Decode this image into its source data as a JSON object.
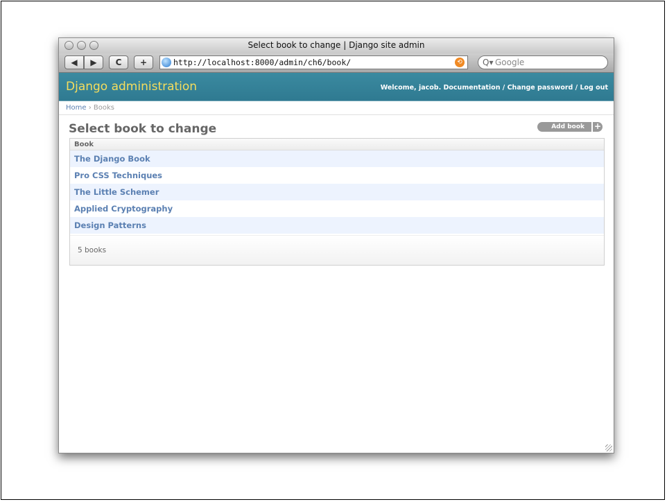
{
  "window": {
    "title": "Select book to change | Django site admin"
  },
  "toolbar": {
    "back_icon": "arrow-left-icon",
    "forward_icon": "arrow-right-icon",
    "reload_icon": "reload-icon",
    "add_icon": "plus-icon",
    "reload_glyph": "C",
    "add_glyph": "+",
    "url": "http://localhost:8000/admin/ch6/book/",
    "search_placeholder": "Google"
  },
  "header": {
    "brand": "Django administration",
    "welcome": "Welcome,",
    "username": "jacob",
    "documentation": "Documentation",
    "change_password": "Change password",
    "log_out": "Log out",
    "sep": "/",
    "brand_color": "#f5dd5d",
    "header_color": "#417690"
  },
  "breadcrumbs": {
    "home": "Home",
    "separator": "›",
    "current": "Books"
  },
  "main": {
    "title": "Select book to change",
    "add_button": "Add book",
    "column_header": "Book",
    "rows": [
      {
        "label": "The Django Book"
      },
      {
        "label": "Pro CSS Techniques"
      },
      {
        "label": "The Little Schemer"
      },
      {
        "label": "Applied Cryptography"
      },
      {
        "label": "Design Patterns"
      }
    ],
    "count": "5 books"
  }
}
